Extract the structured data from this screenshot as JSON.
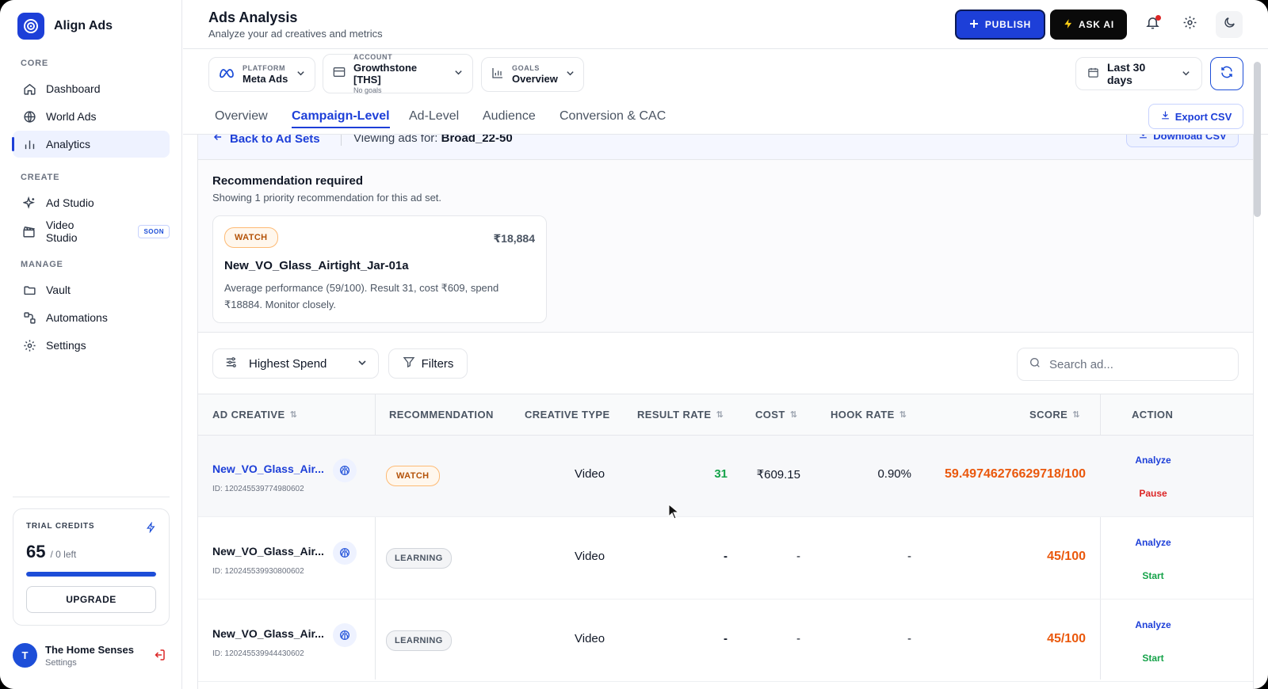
{
  "app": {
    "name": "Align Ads"
  },
  "sidebar": {
    "sections": {
      "core": "CORE",
      "create": "CREATE",
      "manage": "MANAGE"
    },
    "items": [
      {
        "label": "Dashboard",
        "icon": "home-icon"
      },
      {
        "label": "World Ads",
        "icon": "globe-icon"
      },
      {
        "label": "Analytics",
        "icon": "bar-chart-icon",
        "active": true
      },
      {
        "label": "Ad Studio",
        "icon": "sparkles-icon"
      },
      {
        "label": "Video Studio",
        "icon": "clapperboard-icon",
        "badge": "SOON"
      },
      {
        "label": "Vault",
        "icon": "folder-icon"
      },
      {
        "label": "Automations",
        "icon": "workflow-icon"
      },
      {
        "label": "Settings",
        "icon": "gear-icon"
      }
    ],
    "credits": {
      "label": "TRIAL CREDITS",
      "value": "65",
      "sub": "/ 0 left",
      "progress_fraction": 1.0,
      "upgrade_label": "UPGRADE"
    },
    "user": {
      "initial": "T",
      "name": "The Home Senses",
      "sub": "Settings"
    }
  },
  "header": {
    "title": "Ads Analysis",
    "subtitle": "Analyze your ad creatives and metrics",
    "publish_label": "PUBLISH",
    "ask_ai_label": "ASK AI",
    "colors": {
      "publish": "#1d3fd8",
      "ask_ai": "#0a0a0a",
      "notification_dot": "#dc2626"
    }
  },
  "filters": {
    "platform": {
      "label": "PLATFORM",
      "value": "Meta Ads"
    },
    "account": {
      "label": "ACCOUNT",
      "value": "Growthstone [THS]",
      "sub": "No goals"
    },
    "goals": {
      "label": "GOALS",
      "value": "Overview"
    },
    "date_range": "Last 30 days"
  },
  "tabs": {
    "items": [
      "Overview",
      "Campaign-Level",
      "Ad-Level",
      "Audience",
      "Conversion & CAC"
    ],
    "active": "Campaign-Level",
    "export_label": "Export CSV"
  },
  "backbar": {
    "back_label": "Back to Ad Sets",
    "viewing_prefix": "Viewing ads for:",
    "viewing_value": "Broad_22-50",
    "download_label": "Download CSV"
  },
  "recommendation": {
    "title": "Recommendation required",
    "subtitle": "Showing 1 priority recommendation for this ad set.",
    "card": {
      "badge": "WATCH",
      "amount": "₹18,884",
      "name": "New_VO_Glass_Airtight_Jar-01a",
      "description": "Average performance (59/100). Result 31, cost ₹609, spend ₹18884. Monitor closely."
    }
  },
  "toolbar": {
    "sort_label": "Highest Spend",
    "filters_label": "Filters",
    "search_placeholder": "Search ad..."
  },
  "table": {
    "columns": [
      "AD CREATIVE",
      "RECOMMENDATION",
      "CREATIVE TYPE",
      "RESULT RATE",
      "COST",
      "HOOK RATE",
      "SCORE",
      "ACTION"
    ],
    "rows": [
      {
        "name": "New_VO_Glass_Air...",
        "id": "ID: 120245539774980602",
        "recommendation": "WATCH",
        "type": "Video",
        "result_rate": "31",
        "cost": "₹609.15",
        "hook_rate": "0.90%",
        "score": "59.49746276629718/100",
        "action_primary": "Analyze",
        "action_secondary": "Pause"
      },
      {
        "name": "New_VO_Glass_Air...",
        "id": "ID: 120245539930800602",
        "recommendation": "LEARNING",
        "type": "Video",
        "result_rate": "-",
        "cost": "-",
        "hook_rate": "-",
        "score": "45/100",
        "action_primary": "Analyze",
        "action_secondary": "Start"
      },
      {
        "name": "New_VO_Glass_Air...",
        "id": "ID: 120245539944430602",
        "recommendation": "LEARNING",
        "type": "Video",
        "result_rate": "-",
        "cost": "-",
        "hook_rate": "-",
        "score": "45/100",
        "action_primary": "Analyze",
        "action_secondary": "Start"
      }
    ]
  }
}
